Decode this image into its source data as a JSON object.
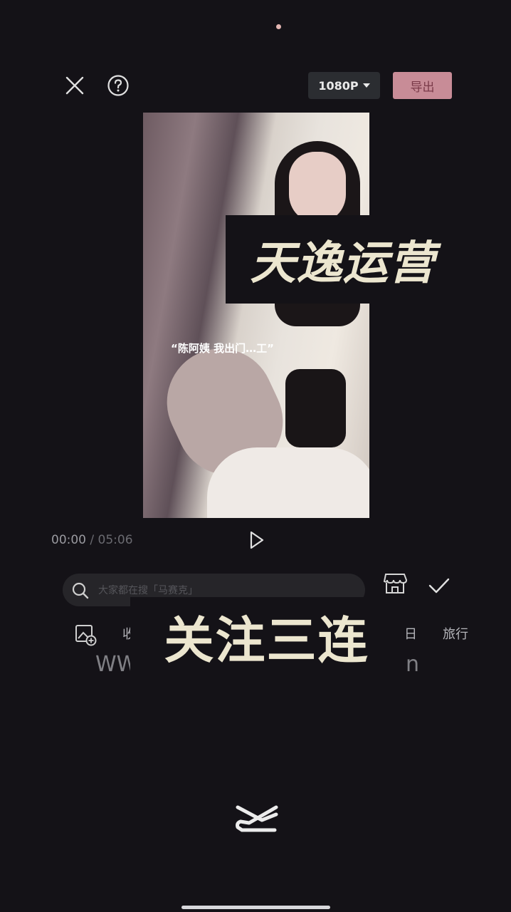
{
  "header": {
    "resolution_label": "1080P",
    "export_label": "导出"
  },
  "video": {
    "subtitle": "“陈阿姨 我出门…工”"
  },
  "overlays": {
    "top_watermark": "天逸运营",
    "bottom_watermark": "关注三连"
  },
  "player": {
    "current_time": "00:00",
    "separator": "/",
    "duration": "05:06"
  },
  "search": {
    "placeholder": "大家都在搜「马赛克」"
  },
  "categories": {
    "left_partial": "收",
    "right_partial": "日",
    "travel": "旅行"
  },
  "partial_text": {
    "left": "WW",
    "right": "n"
  },
  "colors": {
    "background": "#141217",
    "export_button": "#c88c97",
    "watermark_text": "#ece6cf"
  }
}
